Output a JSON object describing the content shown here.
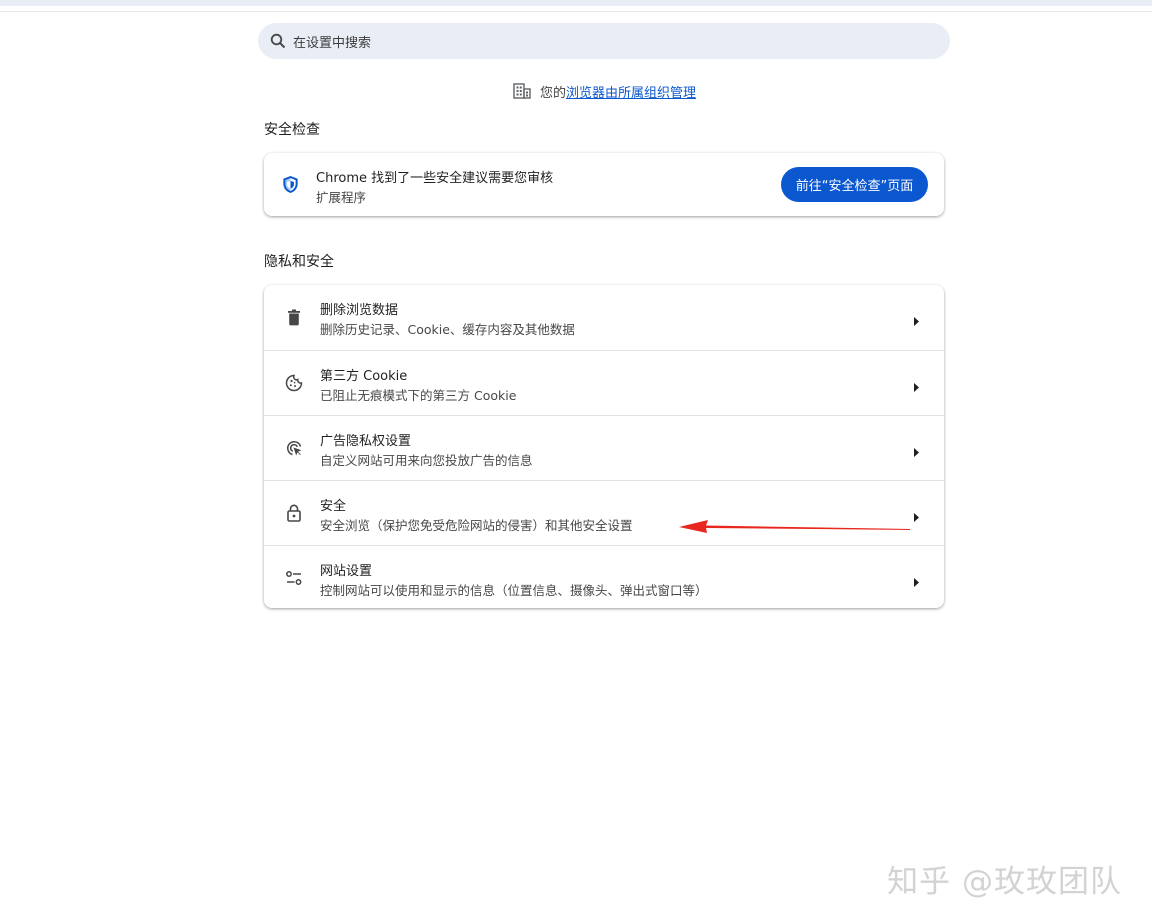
{
  "search": {
    "placeholder": "在设置中搜索"
  },
  "managed": {
    "prefix": "您的",
    "link": "浏览器由所属组织管理"
  },
  "safety_check": {
    "section_title": "安全检查",
    "title": "Chrome 找到了一些安全建议需要您审核",
    "subtitle": "扩展程序",
    "button_label": "前往“安全检查”页面"
  },
  "privacy": {
    "section_title": "隐私和安全",
    "items": [
      {
        "title": "删除浏览数据",
        "subtitle": "删除历史记录、Cookie、缓存内容及其他数据",
        "icon": "trash-icon"
      },
      {
        "title": "第三方 Cookie",
        "subtitle": "已阻止无痕模式下的第三方 Cookie",
        "icon": "cookie-icon"
      },
      {
        "title": "广告隐私权设置",
        "subtitle": "自定义网站可用来向您投放广告的信息",
        "icon": "ad-privacy-icon"
      },
      {
        "title": "安全",
        "subtitle": "安全浏览（保护您免受危险网站的侵害）和其他安全设置",
        "icon": "lock-icon"
      },
      {
        "title": "网站设置",
        "subtitle": "控制网站可以使用和显示的信息（位置信息、摄像头、弹出式窗口等）",
        "icon": "tune-icon"
      }
    ]
  },
  "annotation": {
    "arrow_color": "#e8281e"
  },
  "watermark": "知乎 @玫玫团队",
  "colors": {
    "accent": "#0b57d0",
    "search_bg": "#e9eef6"
  }
}
